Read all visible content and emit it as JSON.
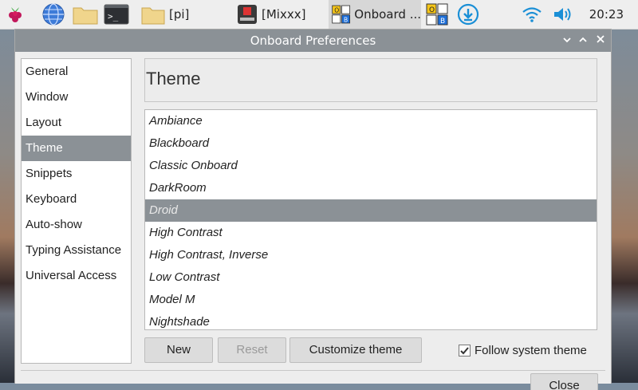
{
  "taskbar": {
    "items": [
      {
        "icon": "raspberry-menu-icon"
      },
      {
        "icon": "web-browser-icon"
      },
      {
        "icon": "file-manager-icon"
      },
      {
        "icon": "terminal-icon"
      },
      {
        "label": "[pi]",
        "icon": "folder-icon"
      },
      {
        "label": "[Mixxx]",
        "icon": "mixxx-app-icon"
      },
      {
        "label": "Onboard ...",
        "icon": "onboard-app-icon"
      },
      {
        "icon": "onboard-tray-icon"
      },
      {
        "icon": "download-icon"
      }
    ],
    "clock": "20:23"
  },
  "window": {
    "title": "Onboard Preferences"
  },
  "sidebar": {
    "items": [
      {
        "label": "General"
      },
      {
        "label": "Window"
      },
      {
        "label": "Layout"
      },
      {
        "label": "Theme"
      },
      {
        "label": "Snippets"
      },
      {
        "label": "Keyboard"
      },
      {
        "label": "Auto-show"
      },
      {
        "label": "Typing Assistance"
      },
      {
        "label": "Universal Access"
      }
    ],
    "selected": "Theme"
  },
  "pane": {
    "title": "Theme"
  },
  "themes": {
    "items": [
      {
        "label": "Ambiance"
      },
      {
        "label": "Blackboard"
      },
      {
        "label": "Classic Onboard"
      },
      {
        "label": "DarkRoom"
      },
      {
        "label": "Droid"
      },
      {
        "label": "High Contrast"
      },
      {
        "label": "High Contrast, Inverse"
      },
      {
        "label": "Low Contrast"
      },
      {
        "label": "Model M"
      },
      {
        "label": "Nightshade"
      }
    ],
    "selected": "Droid"
  },
  "buttons": {
    "new": "New",
    "reset": "Reset",
    "customize": "Customize theme",
    "close": "Close"
  },
  "follow_system_theme": {
    "label": "Follow system theme",
    "checked": true
  },
  "colors": {
    "selection": "#8b9196",
    "titlebar": "#8b9196",
    "taskbar": "#eeeeee"
  }
}
